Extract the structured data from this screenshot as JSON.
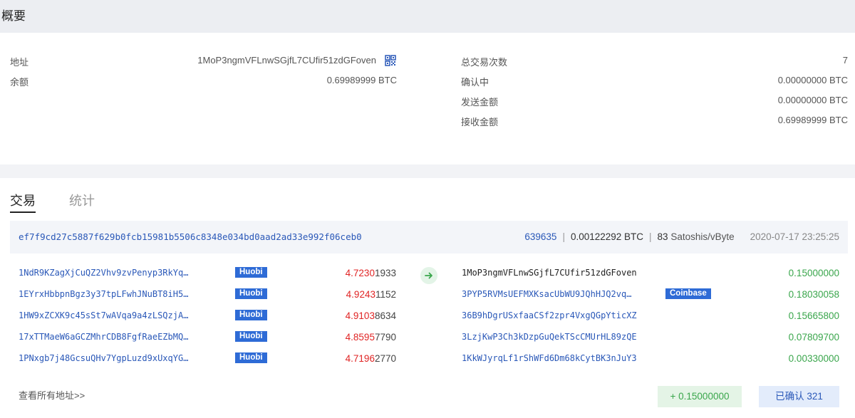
{
  "page": {
    "title": "概要"
  },
  "summary": {
    "left": [
      {
        "label": "地址",
        "value": "1MoP3ngmVFLnwSGjfL7CUfir51zdGFoven"
      },
      {
        "label": "余额",
        "value": "0.69989999 BTC"
      }
    ],
    "right": [
      {
        "label": "总交易次数",
        "value": "7"
      },
      {
        "label": "确认中",
        "value": "0.00000000 BTC"
      },
      {
        "label": "发送金额",
        "value": "0.00000000 BTC"
      },
      {
        "label": "接收金额",
        "value": "0.69989999 BTC"
      }
    ],
    "qr_icon": "qr-code-icon"
  },
  "tabs": [
    {
      "label": "交易",
      "active": true
    },
    {
      "label": "统计",
      "active": false
    }
  ],
  "transaction": {
    "hash": "ef7f9cd27c5887f629b0fcb15981b5506c8348e034bd0aad2ad33e992f06ceb0",
    "block": "639635",
    "fee": "0.00122292 BTC",
    "fee_rate_value": "83",
    "fee_rate_unit": "Satoshis/vByte",
    "time": "2020-07-17 23:25:25",
    "arrow_icon": "arrow-right-icon",
    "inputs": [
      {
        "address": "1NdR9KZagXjCuQZ2Vhv9zvPenyp3RkYq…",
        "tag": "Huobi",
        "amount_hi": "4.7230",
        "amount_lo": "1933"
      },
      {
        "address": "1EYrxHbbpnBgz3y37tpLFwhJNuBT8iH5…",
        "tag": "Huobi",
        "amount_hi": "4.9243",
        "amount_lo": "1152"
      },
      {
        "address": "1HW9xZCXK9c45sSt7wAVqa9a4zLSQzjA…",
        "tag": "Huobi",
        "amount_hi": "4.9103",
        "amount_lo": "8634"
      },
      {
        "address": "17xTTMaeW6aGCZMhrCDB8FgfRaeEZbMQ…",
        "tag": "Huobi",
        "amount_hi": "4.8595",
        "amount_lo": "7790"
      },
      {
        "address": "1PNxgb7j48GcsuQHv7YgpLuzd9xUxqYG…",
        "tag": "Huobi",
        "amount_hi": "4.7196",
        "amount_lo": "2770"
      }
    ],
    "outputs": [
      {
        "address": "1MoP3ngmVFLnwSGjfL7CUfir51zdGFoven",
        "tag": "",
        "amount": "0.15000000"
      },
      {
        "address": "3PYP5RVMsUEFMXKsacUbWU9JQhHJQ2vq…",
        "tag": "Coinbase",
        "amount": "0.18030058"
      },
      {
        "address": "36B9hDgrUSxfaaCSf2zpr4VxgQGpYticXZ",
        "tag": "",
        "amount": "0.15665800"
      },
      {
        "address": "3LzjKwP3Ch3kDzpGuQekTScCMUrHL89zQE",
        "tag": "",
        "amount": "0.07809700"
      },
      {
        "address": "1KkWJyrqLf1rShWFd6Dm68kCytBK3nJuY3",
        "tag": "",
        "amount": "0.00330000"
      }
    ],
    "view_all": "查看所有地址>>",
    "net_change": "+ 0.15000000",
    "confirmations": "已确认 321"
  },
  "colors": {
    "link": "#2a58b8",
    "tag": "#2e6bd6",
    "in_amount": "#e02424",
    "out_amount": "#3aa64c"
  }
}
